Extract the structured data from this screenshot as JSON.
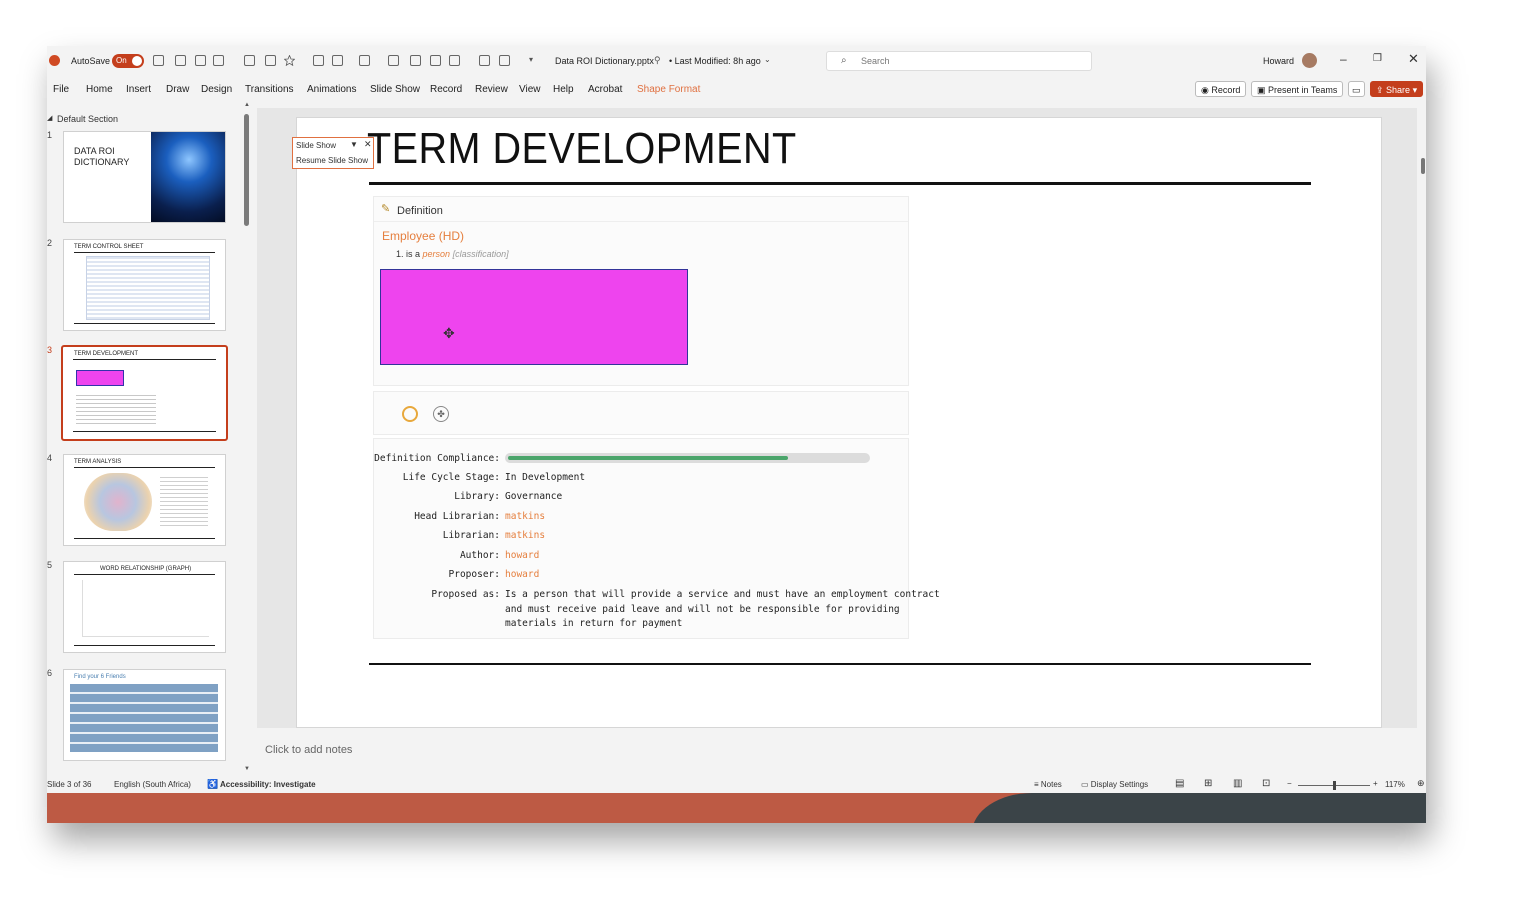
{
  "titlebar": {
    "autosave_label": "AutoSave",
    "autosave_state": "On",
    "file_name": "Data ROI Dictionary.pptx",
    "last_modified": "• Last Modified: 8h ago",
    "search_placeholder": "Search",
    "user_name": "Howard"
  },
  "menu": {
    "items": [
      "File",
      "Home",
      "Insert",
      "Draw",
      "Design",
      "Transitions",
      "Animations",
      "Slide Show",
      "Record",
      "Review",
      "View",
      "Help",
      "Acrobat",
      "Shape Format"
    ],
    "active_color": "#e07040",
    "record_button": "Record",
    "present_button": "Present in Teams",
    "share_button": "Share"
  },
  "slides_pane": {
    "section_title": "Default Section",
    "slides": [
      {
        "number": "1",
        "title": "DATA ROI DICTIONARY"
      },
      {
        "number": "2",
        "title": "TERM CONTROL SHEET"
      },
      {
        "number": "3",
        "title": "TERM DEVELOPMENT"
      },
      {
        "number": "4",
        "title": "TERM ANALYSIS"
      },
      {
        "number": "5",
        "title": "WORD RELATIONSHIP (GRAPH)"
      },
      {
        "number": "6",
        "title": "Find your 6 Friends"
      }
    ],
    "selected_index": 2
  },
  "slideshow_popup": {
    "title": "Slide Show",
    "resume": "Resume Slide Show"
  },
  "slide": {
    "title": "TERM DEVELOPMENT",
    "definition_header": "Definition",
    "term_name": "Employee (HD)",
    "def_prefix": "1.  is a",
    "def_link": "person",
    "def_class": "[classification]",
    "shape_color": "#ee44ee",
    "compliance_fraction": 0.78,
    "fields": [
      {
        "label": "Definition Compliance:",
        "value": ""
      },
      {
        "label": "Life Cycle Stage:",
        "value": "In Development"
      },
      {
        "label": "Library:",
        "value": "Governance"
      },
      {
        "label": "Head Librarian:",
        "value": "matkins"
      },
      {
        "label": "Librarian:",
        "value": "matkins"
      },
      {
        "label": "Author:",
        "value": "howard"
      },
      {
        "label": "Proposer:",
        "value": "howard"
      },
      {
        "label": "Proposed as:",
        "value": ""
      }
    ],
    "proposed_lines": [
      "Is a person that will provide a service and must have an employment contract",
      "and must receive paid leave and will not be responsible for providing",
      "materials in return for payment"
    ]
  },
  "notes_placeholder": "Click to add notes",
  "status": {
    "slide_counter": "Slide 3 of 36",
    "language": "English (South Africa)",
    "accessibility": "Accessibility: Investigate",
    "notes": "Notes",
    "display_settings": "Display Settings",
    "zoom": "117%"
  }
}
